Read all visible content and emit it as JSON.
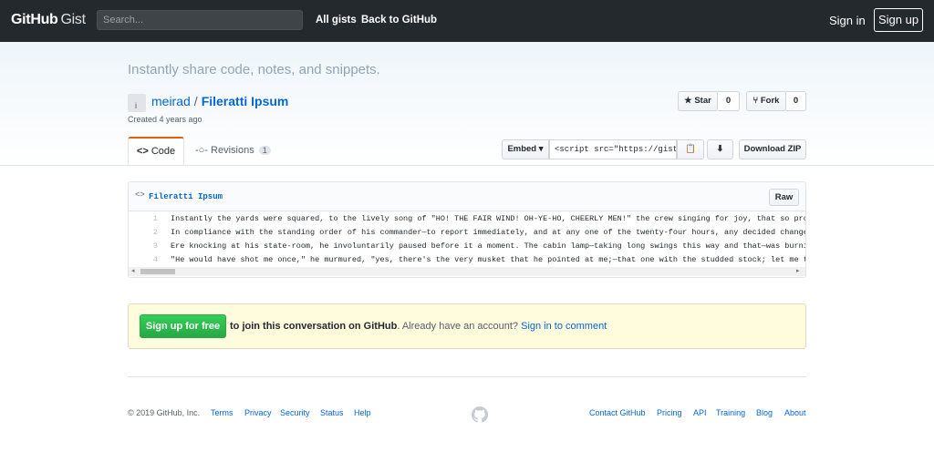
{
  "header": {
    "logo_github": "GitHub",
    "logo_gist": "Gist",
    "search_placeholder": "Search...",
    "nav": [
      "All gists",
      "Back to GitHub"
    ],
    "sign_in": "Sign in",
    "sign_up": "Sign up"
  },
  "hero": {
    "tagline": "Instantly share code, notes, and snippets.",
    "owner": "meirad",
    "gist_name": "Fileratti Ipsum",
    "created": "Created 4 years ago",
    "star_label": "Star",
    "star_count": "0",
    "fork_label": "Fork",
    "fork_count": "0",
    "tabs": {
      "code": "Code",
      "revisions": "Revisions",
      "revisions_count": "1"
    },
    "embed_label": "Embed",
    "embed_value": "<script src=\"https://gist.",
    "download": "Download ZIP"
  },
  "file": {
    "name": "Fileratti Ipsum",
    "raw": "Raw",
    "lines": [
      {
        "n": "1",
        "text": "Instantly the yards were squared, to the lively song of \"HO! THE FAIR WIND! OH-YE-HO, CHEERLY MEN!\" the crew singing for joy, that so promi"
      },
      {
        "n": "2",
        "text": "In compliance with the standing order of his commander—to report immediately, and at any one of the twenty-four hours, any decided change i"
      },
      {
        "n": "3",
        "text": "Ere knocking at his state-room, he involuntarily paused before it a moment. The cabin lamp—taking long swings this way and that—was burning"
      },
      {
        "n": "4",
        "text": "\"He would have shot me once,\" he murmured, \"yes, there's the very musket that he pointed at me;—that one with the studded stock; let me tou"
      }
    ]
  },
  "comment": {
    "button": "Sign up for free",
    "bold_text": "to join this conversation on GitHub",
    "mid_text": ". Already have an account? ",
    "link": "Sign in to comment"
  },
  "footer": {
    "copyright": "© 2019 GitHub, Inc.",
    "left_links": [
      "Terms",
      "Privacy",
      "Security",
      "Status",
      "Help"
    ],
    "right_links": [
      "Contact GitHub",
      "Pricing",
      "API",
      "Training",
      "Blog",
      "About"
    ]
  },
  "colors": {
    "header_bg": "#24292e",
    "link": "#0366d6",
    "accent_tab": "#e36209",
    "signup_green": "#28a745"
  }
}
